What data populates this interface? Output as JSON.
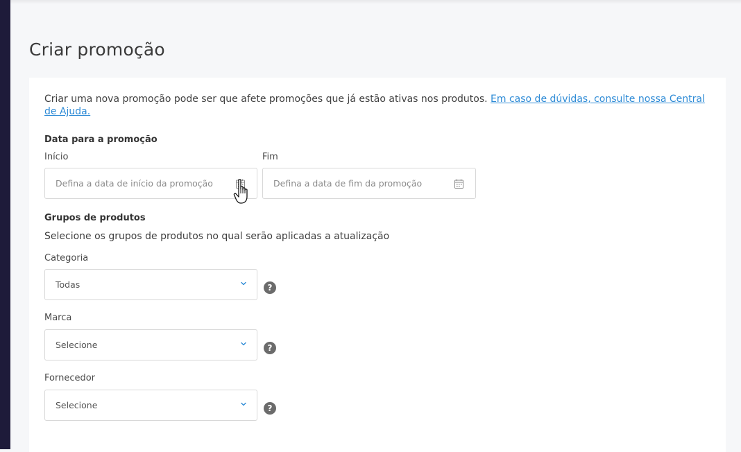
{
  "page": {
    "title": "Criar promoção"
  },
  "intro": {
    "text": "Criar uma nova promoção pode ser que afete promoções que já estão ativas nos produtos.",
    "help_link": "Em caso de dúvidas, consulte nossa Central de Ajuda."
  },
  "dates": {
    "section_title": "Data para a promoção",
    "start": {
      "label": "Início",
      "placeholder": "Defina a data de início da promoção",
      "icon": "calendar-icon"
    },
    "end": {
      "label": "Fim",
      "placeholder": "Defina a data de fim da promoção",
      "icon": "calendar-icon"
    }
  },
  "product_groups": {
    "section_title": "Grupos de produtos",
    "subtitle": "Selecione os grupos de produtos no qual serão aplicadas a atualização",
    "category": {
      "label": "Categoria",
      "value": "Todas"
    },
    "brand": {
      "label": "Marca",
      "value": "Selecione"
    },
    "supplier": {
      "label": "Fornecedor",
      "value": "Selecione"
    },
    "help_glyph": "?"
  },
  "colors": {
    "sidebar": "#1e1b3a",
    "link": "#2e8bd6",
    "chevron": "#2e8bd6",
    "help_icon": "#6b6b6b"
  }
}
